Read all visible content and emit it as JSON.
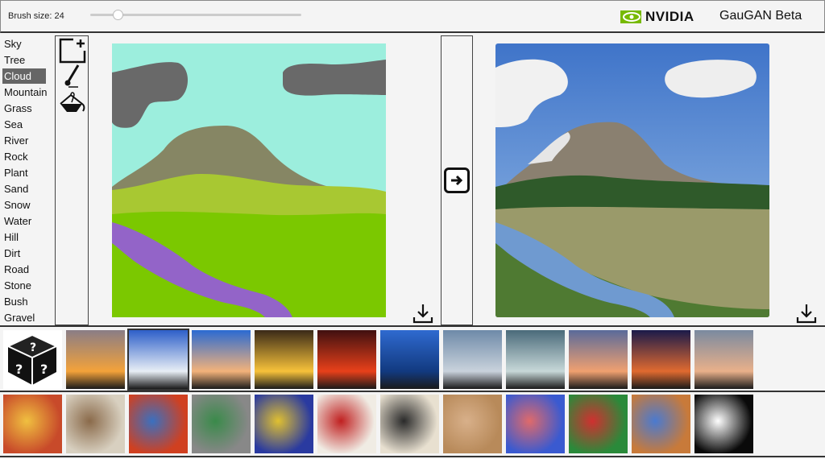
{
  "header": {
    "brush_size_label": "Brush size: 24",
    "brush_size": 24,
    "brush_slider_fraction": 0.13,
    "brand": "NVIDIA",
    "brand_color": "#76b900",
    "title": "GauGAN Beta"
  },
  "labels": [
    {
      "name": "Sky",
      "color": "#9ceedd"
    },
    {
      "name": "Tree",
      "color": "#a8c832"
    },
    {
      "name": "Cloud",
      "color": "#696969",
      "selected": true
    },
    {
      "name": "Mountain",
      "color": "#868664"
    },
    {
      "name": "Grass",
      "color": "#7bc800"
    },
    {
      "name": "Sea",
      "color": "#3c64c8"
    },
    {
      "name": "River",
      "color": "#9364c8"
    },
    {
      "name": "Rock",
      "color": "#565656"
    },
    {
      "name": "Plant",
      "color": "#a3c832"
    },
    {
      "name": "Sand",
      "color": "#999900"
    },
    {
      "name": "Snow",
      "color": "#ffffff"
    },
    {
      "name": "Water",
      "color": "#0d3dce"
    },
    {
      "name": "Hill",
      "color": "#b6c8a0"
    },
    {
      "name": "Dirt",
      "color": "#6e6e28"
    },
    {
      "name": "Road",
      "color": "#808080"
    },
    {
      "name": "Stone",
      "color": "#d3d3d3"
    },
    {
      "name": "Bush",
      "color": "#5f9f4f"
    },
    {
      "name": "Gravel",
      "color": "#a0a0a0"
    }
  ],
  "tools": [
    "new-canvas-icon",
    "brush-icon",
    "fill-bucket-icon"
  ],
  "style_rows": {
    "photos": [
      [
        "#8a7d86",
        "#f3a23a"
      ],
      [
        "#2d5fc9",
        "#e8eef5"
      ],
      [
        "#2a6ad2",
        "#f3b27a"
      ],
      [
        "#3a2a18",
        "#f7c23a"
      ],
      [
        "#401010",
        "#e8401a"
      ],
      [
        "#2f6ad0",
        "#123a80"
      ],
      [
        "#6e8aa8",
        "#c9d2dc"
      ],
      [
        "#4a6a7a",
        "#c7d8d8"
      ],
      [
        "#5a6a9a",
        "#f0a070"
      ],
      [
        "#1a1a4a",
        "#e06a30"
      ],
      [
        "#7a8aa0",
        "#e9b08a"
      ]
    ],
    "paintings": [
      [
        "#c84a2a",
        "#f0c040"
      ],
      [
        "#d8d0c0",
        "#8a6a4a"
      ],
      [
        "#d04020",
        "#3a70c0"
      ],
      [
        "#888888",
        "#3a8a4a"
      ],
      [
        "#2a3aa0",
        "#e0c030"
      ],
      [
        "#f0ece4",
        "#c02020"
      ],
      [
        "#e8e0d0",
        "#2a2a2a"
      ],
      [
        "#b88a5a",
        "#d8b08a"
      ],
      [
        "#3a5ad0",
        "#e06a6a"
      ],
      [
        "#2a8a3a",
        "#d03030"
      ],
      [
        "#c87a3a",
        "#4a7ad0"
      ],
      [
        "#0a0a0a",
        "#ffffff"
      ]
    ]
  }
}
